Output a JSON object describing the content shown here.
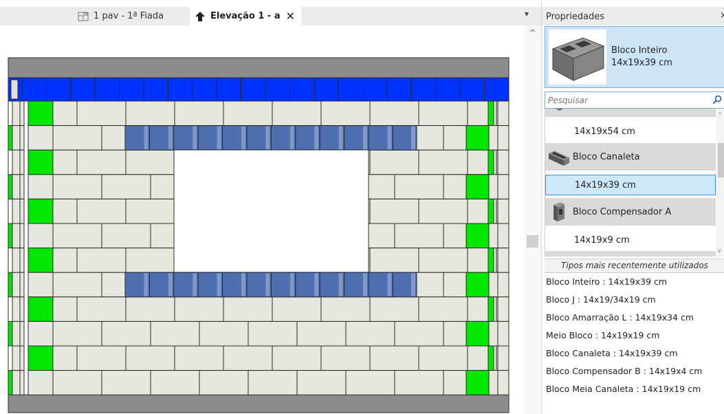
{
  "tabs": [
    {
      "label": "1 pav - 1ª Fiada",
      "icon": "floor-plan-icon",
      "active": false
    },
    {
      "label": "Elevação 1 - a",
      "icon": "elevation-icon",
      "active": true
    }
  ],
  "tab_close_glyph": "✕",
  "tab_menu_glyph": "▾",
  "properties": {
    "title": "Propriedades",
    "close_glyph": "×",
    "type_selector": {
      "family": "Bloco Inteiro",
      "type": "14x19x39 cm",
      "icon": "concrete-block-icon"
    },
    "search": {
      "placeholder": "Pesquisar",
      "icon": "search-icon"
    },
    "dropdown_items": [
      {
        "kind": "type",
        "label": "14x19x54 cm"
      },
      {
        "kind": "family",
        "label": "Bloco Canaleta",
        "icon": "channel-block-icon"
      },
      {
        "kind": "type",
        "label": "14x19x39 cm",
        "selected": true
      },
      {
        "kind": "family",
        "label": "Bloco Compensador A",
        "icon": "compensator-block-icon"
      },
      {
        "kind": "type",
        "label": "14x19x9 cm"
      }
    ],
    "recent_header": "Tipos mais recentemente utilizados",
    "recent_items": [
      "Bloco Inteiro : 14x19x39 cm",
      "Bloco J : 14x19/34x19 cm",
      "Bloco Amarração L : 14x19x34 cm",
      "Meio Bloco : 14x19x19 cm",
      "Bloco Canaleta : 14x19x39 cm",
      "Bloco Compensador B : 14x19x4 cm",
      "Bloco Meia Canaleta : 14x19x19 cm"
    ]
  },
  "colors": {
    "block": "#e8e7dd",
    "block_shadow": "#cfcec4",
    "mortar": "#2a2a2a",
    "bond_beam": "#0033ff",
    "lintel": "#4d6fb0",
    "lintel_light": "#7f98c8",
    "edge_block": "#00e600",
    "slab": "#8c8c8c"
  }
}
